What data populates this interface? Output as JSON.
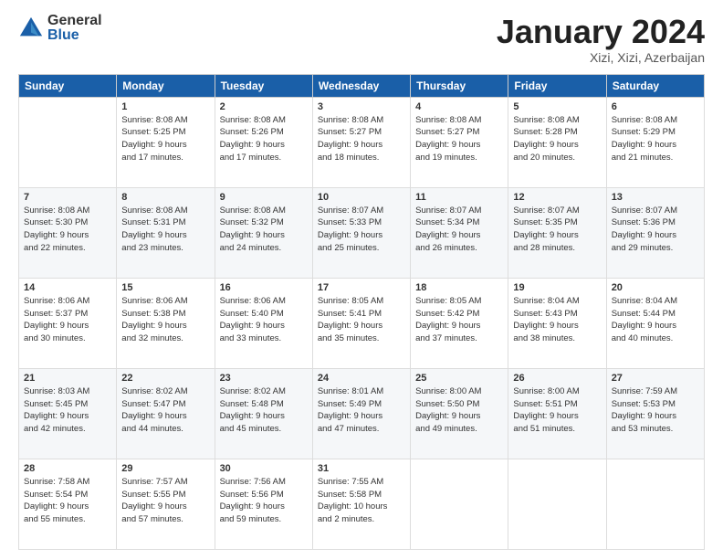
{
  "logo": {
    "general": "General",
    "blue": "Blue"
  },
  "header": {
    "month": "January 2024",
    "location": "Xizi, Xizi, Azerbaijan"
  },
  "weekdays": [
    "Sunday",
    "Monday",
    "Tuesday",
    "Wednesday",
    "Thursday",
    "Friday",
    "Saturday"
  ],
  "weeks": [
    [
      {
        "day": "",
        "info": ""
      },
      {
        "day": "1",
        "info": "Sunrise: 8:08 AM\nSunset: 5:25 PM\nDaylight: 9 hours\nand 17 minutes."
      },
      {
        "day": "2",
        "info": "Sunrise: 8:08 AM\nSunset: 5:26 PM\nDaylight: 9 hours\nand 17 minutes."
      },
      {
        "day": "3",
        "info": "Sunrise: 8:08 AM\nSunset: 5:27 PM\nDaylight: 9 hours\nand 18 minutes."
      },
      {
        "day": "4",
        "info": "Sunrise: 8:08 AM\nSunset: 5:27 PM\nDaylight: 9 hours\nand 19 minutes."
      },
      {
        "day": "5",
        "info": "Sunrise: 8:08 AM\nSunset: 5:28 PM\nDaylight: 9 hours\nand 20 minutes."
      },
      {
        "day": "6",
        "info": "Sunrise: 8:08 AM\nSunset: 5:29 PM\nDaylight: 9 hours\nand 21 minutes."
      }
    ],
    [
      {
        "day": "7",
        "info": "Sunrise: 8:08 AM\nSunset: 5:30 PM\nDaylight: 9 hours\nand 22 minutes."
      },
      {
        "day": "8",
        "info": "Sunrise: 8:08 AM\nSunset: 5:31 PM\nDaylight: 9 hours\nand 23 minutes."
      },
      {
        "day": "9",
        "info": "Sunrise: 8:08 AM\nSunset: 5:32 PM\nDaylight: 9 hours\nand 24 minutes."
      },
      {
        "day": "10",
        "info": "Sunrise: 8:07 AM\nSunset: 5:33 PM\nDaylight: 9 hours\nand 25 minutes."
      },
      {
        "day": "11",
        "info": "Sunrise: 8:07 AM\nSunset: 5:34 PM\nDaylight: 9 hours\nand 26 minutes."
      },
      {
        "day": "12",
        "info": "Sunrise: 8:07 AM\nSunset: 5:35 PM\nDaylight: 9 hours\nand 28 minutes."
      },
      {
        "day": "13",
        "info": "Sunrise: 8:07 AM\nSunset: 5:36 PM\nDaylight: 9 hours\nand 29 minutes."
      }
    ],
    [
      {
        "day": "14",
        "info": "Sunrise: 8:06 AM\nSunset: 5:37 PM\nDaylight: 9 hours\nand 30 minutes."
      },
      {
        "day": "15",
        "info": "Sunrise: 8:06 AM\nSunset: 5:38 PM\nDaylight: 9 hours\nand 32 minutes."
      },
      {
        "day": "16",
        "info": "Sunrise: 8:06 AM\nSunset: 5:40 PM\nDaylight: 9 hours\nand 33 minutes."
      },
      {
        "day": "17",
        "info": "Sunrise: 8:05 AM\nSunset: 5:41 PM\nDaylight: 9 hours\nand 35 minutes."
      },
      {
        "day": "18",
        "info": "Sunrise: 8:05 AM\nSunset: 5:42 PM\nDaylight: 9 hours\nand 37 minutes."
      },
      {
        "day": "19",
        "info": "Sunrise: 8:04 AM\nSunset: 5:43 PM\nDaylight: 9 hours\nand 38 minutes."
      },
      {
        "day": "20",
        "info": "Sunrise: 8:04 AM\nSunset: 5:44 PM\nDaylight: 9 hours\nand 40 minutes."
      }
    ],
    [
      {
        "day": "21",
        "info": "Sunrise: 8:03 AM\nSunset: 5:45 PM\nDaylight: 9 hours\nand 42 minutes."
      },
      {
        "day": "22",
        "info": "Sunrise: 8:02 AM\nSunset: 5:47 PM\nDaylight: 9 hours\nand 44 minutes."
      },
      {
        "day": "23",
        "info": "Sunrise: 8:02 AM\nSunset: 5:48 PM\nDaylight: 9 hours\nand 45 minutes."
      },
      {
        "day": "24",
        "info": "Sunrise: 8:01 AM\nSunset: 5:49 PM\nDaylight: 9 hours\nand 47 minutes."
      },
      {
        "day": "25",
        "info": "Sunrise: 8:00 AM\nSunset: 5:50 PM\nDaylight: 9 hours\nand 49 minutes."
      },
      {
        "day": "26",
        "info": "Sunrise: 8:00 AM\nSunset: 5:51 PM\nDaylight: 9 hours\nand 51 minutes."
      },
      {
        "day": "27",
        "info": "Sunrise: 7:59 AM\nSunset: 5:53 PM\nDaylight: 9 hours\nand 53 minutes."
      }
    ],
    [
      {
        "day": "28",
        "info": "Sunrise: 7:58 AM\nSunset: 5:54 PM\nDaylight: 9 hours\nand 55 minutes."
      },
      {
        "day": "29",
        "info": "Sunrise: 7:57 AM\nSunset: 5:55 PM\nDaylight: 9 hours\nand 57 minutes."
      },
      {
        "day": "30",
        "info": "Sunrise: 7:56 AM\nSunset: 5:56 PM\nDaylight: 9 hours\nand 59 minutes."
      },
      {
        "day": "31",
        "info": "Sunrise: 7:55 AM\nSunset: 5:58 PM\nDaylight: 10 hours\nand 2 minutes."
      },
      {
        "day": "",
        "info": ""
      },
      {
        "day": "",
        "info": ""
      },
      {
        "day": "",
        "info": ""
      }
    ]
  ]
}
